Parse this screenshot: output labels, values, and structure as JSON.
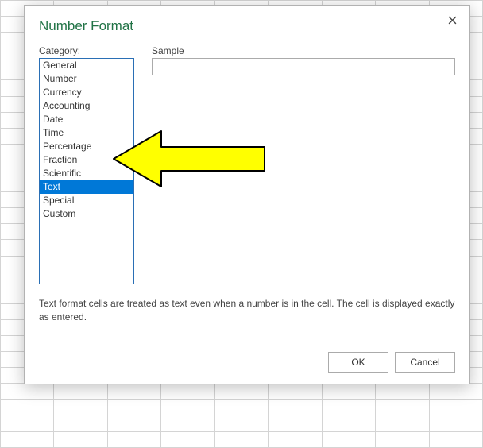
{
  "dialog": {
    "title": "Number Format",
    "category_label": "Category:",
    "sample_label": "Sample",
    "description": "Text format cells are treated as text even when a number is in the cell. The cell is displayed exactly as entered.",
    "ok_label": "OK",
    "cancel_label": "Cancel",
    "selected_index": 9,
    "categories": [
      "General",
      "Number",
      "Currency",
      "Accounting",
      "Date",
      "Time",
      "Percentage",
      "Fraction",
      "Scientific",
      "Text",
      "Special",
      "Custom"
    ]
  }
}
